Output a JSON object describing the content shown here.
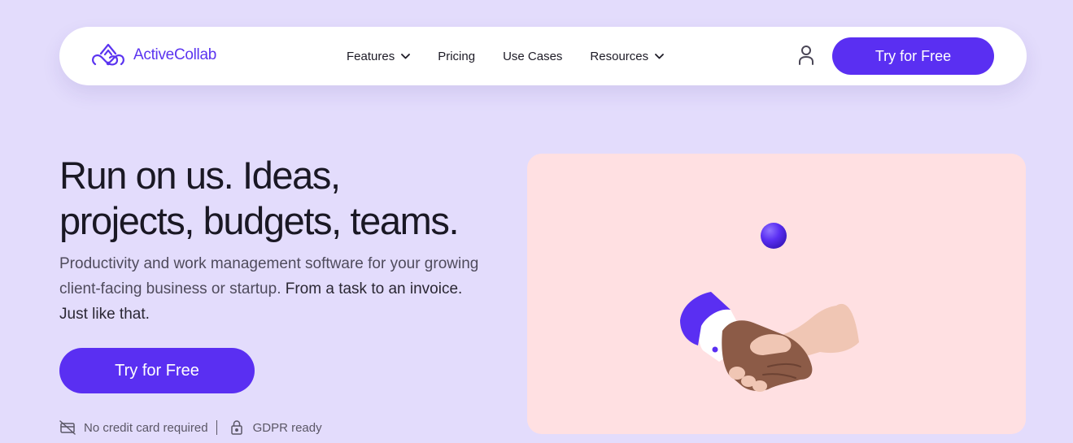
{
  "brand": {
    "name": "ActiveCollab",
    "logo_icon": "activecollab-logo-icon",
    "accent_color": "#5a2ff2"
  },
  "nav": {
    "items": [
      {
        "label": "Features",
        "has_dropdown": true
      },
      {
        "label": "Pricing",
        "has_dropdown": false
      },
      {
        "label": "Use Cases",
        "has_dropdown": false
      },
      {
        "label": "Resources",
        "has_dropdown": true
      }
    ],
    "user_icon": "user-icon",
    "cta_label": "Try for Free"
  },
  "hero": {
    "title_line1": "Run on us. Ideas,",
    "title_line2": "projects, budgets, teams.",
    "subtitle": "Productivity and work management software for your growing client-facing business or startup.",
    "subtitle_strong": "From a task to an invoice. Just like that.",
    "cta_label": "Try for Free",
    "badges": [
      {
        "icon": "no-credit-card-icon",
        "label": "No credit card required"
      },
      {
        "icon": "lock-icon",
        "label": "GDPR ready"
      }
    ]
  },
  "illustration": {
    "name": "handshake-illustration",
    "background": "#ffe0e2"
  }
}
